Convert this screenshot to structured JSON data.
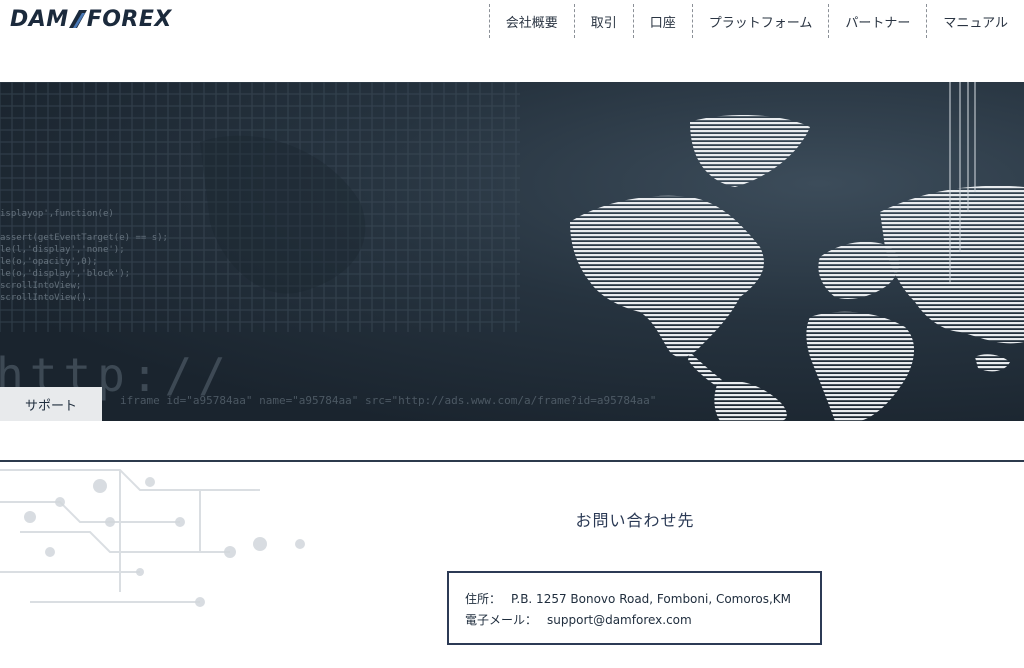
{
  "brand": {
    "logo_text_left": "DAM",
    "logo_text_right": "FOREX"
  },
  "nav": {
    "items": [
      "会社概要",
      "取引",
      "口座",
      "プラットフォーム",
      "パートナー",
      "マニュアル"
    ]
  },
  "hero": {
    "code_lines": "isplayop',function(e)\n\nassert(getEventTarget(e) == s);\nle(l,'display','none');\nle(o,'opacity',0);\nle(o,'display','block');\nscrollIntoView;\nscrollIntoView().",
    "http_text": "http://",
    "iframe_text": "iframe id=\"a95784aa\" name=\"a95784aa\" src=\"http://ads.www.com/a/frame?id=a95784aa\"",
    "tab_label": "サポート"
  },
  "contact": {
    "title": "お問い合わせ先",
    "address_label": "住所：",
    "address_value": "P.B. 1257 Bonovo Road, Fomboni, Comoros,KM",
    "email_label": "電子メール：",
    "email_value": "support@damforex.com"
  },
  "colors": {
    "navy": "#2c3a55",
    "hero_dark": "#1a242e",
    "tab_bg": "#e8eaec"
  }
}
